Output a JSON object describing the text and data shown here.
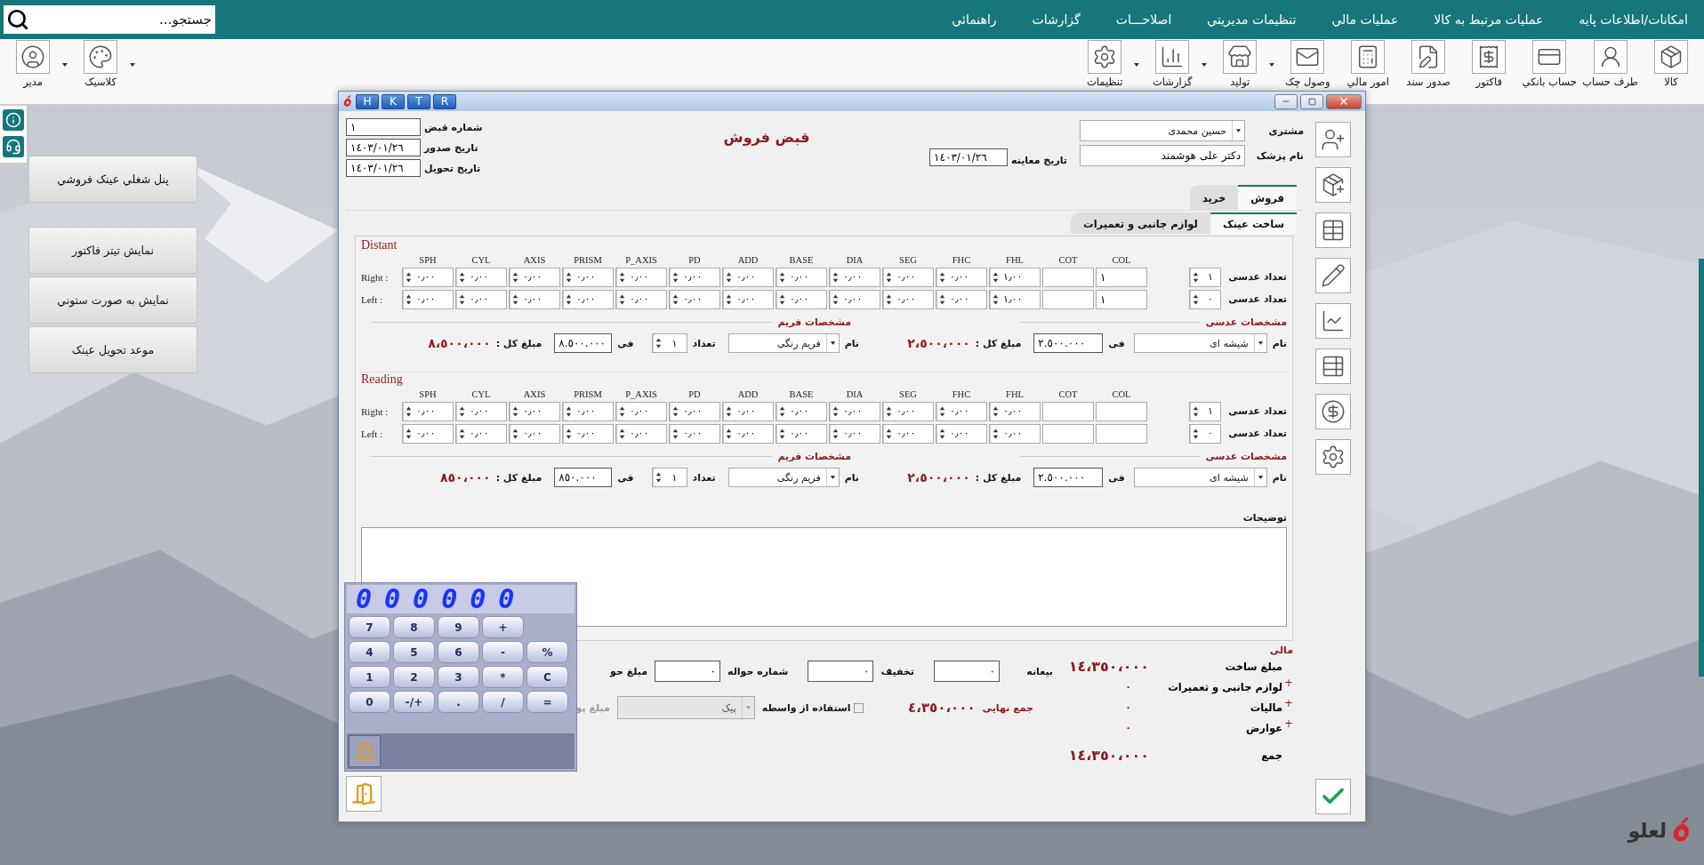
{
  "search": {
    "placeholder": "جستجو..."
  },
  "menu": [
    "امکانات/اطلاعات پایه",
    "عملیات مرتبط به کالا",
    "عملیات مالي",
    "تنظیمات مدیریتي",
    "اصلاحـــات",
    "گزارشات",
    "راهنمائي"
  ],
  "toolbar": [
    {
      "label": "کالا",
      "dropdown": false
    },
    {
      "label": "طرف حساب",
      "dropdown": false
    },
    {
      "label": "حساب بانکي",
      "dropdown": false
    },
    {
      "label": "فاکتور",
      "dropdown": false
    },
    {
      "label": "صدور سند",
      "dropdown": false
    },
    {
      "label": "امور مالي",
      "dropdown": false
    },
    {
      "label": "وصول چک",
      "dropdown": false
    },
    {
      "label": "تولید",
      "dropdown": true
    },
    {
      "label": "گزارشات",
      "dropdown": true
    },
    {
      "label": "تنظیمات",
      "dropdown": true
    }
  ],
  "user_tools": [
    {
      "label": "کلاسیک",
      "dropdown": true
    },
    {
      "label": "مدیر",
      "dropdown": true
    }
  ],
  "side_buttons": [
    "پنل شغلي عینک فروشي",
    "نمایش تیتر فاکتور",
    "نمایش به صورت ستوني",
    "موعد تحویل عینک"
  ],
  "logo": "لعلو",
  "dialog": {
    "title_buttons": [
      "R",
      "T",
      "K",
      "H"
    ],
    "title": "قبض فروش",
    "receipt": [
      {
        "label": "شماره قبض",
        "value": "١"
      },
      {
        "label": "تاریخ صدور",
        "value": "١٤٠٣/٠١/٢٦"
      },
      {
        "label": "تاریخ تحویل",
        "value": "١٤٠٣/٠١/٢٦"
      }
    ],
    "customer": {
      "label": "مشتری",
      "value": "حسین محمدی"
    },
    "doctor": {
      "label": "نام پزشک",
      "value": "دکتر علی هوشمند"
    },
    "exam_date": {
      "label": "تاریخ معاینه",
      "value": "١٤٠٣/٠١/٢٦"
    },
    "tabs": [
      {
        "label": "فروش",
        "selected": true
      },
      {
        "label": "خرید",
        "selected": false
      }
    ],
    "subtabs": [
      {
        "label": "ساخت عینک",
        "selected": true
      },
      {
        "label": "لوازم جانبی و تعمیرات",
        "selected": false
      }
    ],
    "prescriptions": [
      {
        "title": "Distant",
        "columns": [
          {
            "name": "COL",
            "kind": "text"
          },
          {
            "name": "COT",
            "kind": "text"
          },
          {
            "name": "FHL",
            "kind": "spin"
          },
          {
            "name": "FHC",
            "kind": "spin"
          },
          {
            "name": "SEG",
            "kind": "spin"
          },
          {
            "name": "DIA",
            "kind": "spin"
          },
          {
            "name": "BASE",
            "kind": "spin"
          },
          {
            "name": "ADD",
            "kind": "spin"
          },
          {
            "name": "PD",
            "kind": "spin"
          },
          {
            "name": "P_AXIS",
            "kind": "spin"
          },
          {
            "name": "PRISM",
            "kind": "spin"
          },
          {
            "name": "AXIS",
            "kind": "spin"
          },
          {
            "name": "CYL",
            "kind": "spin"
          },
          {
            "name": "SPH",
            "kind": "spin"
          }
        ],
        "rows": [
          {
            "label": "Right :",
            "cells": [
              "١",
              null,
              "١٫٠٠",
              "٠٫٠٠",
              "٠٫٠٠",
              "٠٫٠٠",
              "٠٫٠٠",
              "٠٫٠٠",
              "٠٫٠٠",
              "٠٫٠٠",
              "٠٫٠٠",
              "٠٫٠٠",
              "٠٫٠٠",
              "٠٫٠٠"
            ],
            "count_label": "تعداد عدسی",
            "count": "١"
          },
          {
            "label": "Left :",
            "cells": [
              "١",
              null,
              "١٫٠٠",
              "٠٫٠٠",
              "٠٫٠٠",
              "٠٫٠٠",
              "٠٫٠٠",
              "٠٫٠٠",
              "٠٫٠٠",
              "٠٫٠٠",
              "٠٫٠٠",
              "٠٫٠٠",
              "٠٫٠٠",
              "٠٫٠٠"
            ],
            "count_label": "تعداد عدسی",
            "count": "٠"
          }
        ],
        "lens": {
          "heading": "مشخصات عدسی",
          "name_label": "نام",
          "name": "شیشه ای",
          "fee_label": "فی",
          "fee": "٢.٥٠٠.٠٠٠",
          "total_label": "مبلغ کل :",
          "total": "٢،٥٠٠،٠٠٠"
        },
        "frame": {
          "heading": "مشخصات فریم",
          "name_label": "نام",
          "name": "فریم رنگی",
          "count_label": "تعداد",
          "count": "١",
          "fee_label": "فی",
          "fee": "٨.٥٠٠.٠٠٠",
          "total_label": "مبلغ کل :",
          "total": "٨،٥٠٠،٠٠٠"
        }
      },
      {
        "title": "Reading",
        "columns": [
          {
            "name": "COL",
            "kind": "text"
          },
          {
            "name": "COT",
            "kind": "text"
          },
          {
            "name": "FHL",
            "kind": "spin"
          },
          {
            "name": "FHC",
            "kind": "spin"
          },
          {
            "name": "SEG",
            "kind": "spin"
          },
          {
            "name": "DIA",
            "kind": "spin"
          },
          {
            "name": "BASE",
            "kind": "spin"
          },
          {
            "name": "ADD",
            "kind": "spin"
          },
          {
            "name": "PD",
            "kind": "spin"
          },
          {
            "name": "P_AXIS",
            "kind": "spin"
          },
          {
            "name": "PRISM",
            "kind": "spin"
          },
          {
            "name": "AXIS",
            "kind": "spin"
          },
          {
            "name": "CYL",
            "kind": "spin"
          },
          {
            "name": "SPH",
            "kind": "spin"
          }
        ],
        "rows": [
          {
            "label": "Right :",
            "cells": [
              null,
              null,
              "٠٫٠٠",
              "٠٫٠٠",
              "٠٫٠٠",
              "٠٫٠٠",
              "٠٫٠٠",
              "٠٫٠٠",
              "٠٫٠٠",
              "٠٫٠٠",
              "٠٫٠٠",
              "٠٫٠٠",
              "٠٫٠٠",
              "٠٫٠٠"
            ],
            "count_label": "تعداد عدسی",
            "count": "١"
          },
          {
            "label": "Left :",
            "cells": [
              null,
              null,
              "٠٫٠٠",
              "٠٫٠٠",
              "٠٫٠٠",
              "٠٫٠٠",
              "٠٫٠٠",
              "٠٫٠٠",
              "٠٫٠٠",
              "٠٫٠٠",
              "٠٫٠٠",
              "٠٫٠٠",
              "٠٫٠٠",
              "٠٫٠٠"
            ],
            "count_label": "تعداد عدسی",
            "count": "٠"
          }
        ],
        "lens": {
          "heading": "مشخصات عدسی",
          "name_label": "نام",
          "name": "شیشه ای",
          "fee_label": "فی",
          "fee": "٢.٥٠٠.٠٠٠",
          "total_label": "مبلغ کل :",
          "total": "٢،٥٠٠،٠٠٠"
        },
        "frame": {
          "heading": "مشخصات فریم",
          "name_label": "نام",
          "name": "فریم رنگی",
          "count_label": "تعداد",
          "count": "١",
          "fee_label": "فی",
          "fee": "٨٥٠.٠٠٠",
          "total_label": "مبلغ کل :",
          "total": "٨٥٠،٠٠٠"
        }
      }
    ],
    "notes_label": "توضیحات",
    "finance": {
      "heading": "مالی",
      "summary": [
        {
          "kind": "total",
          "label": "مبلغ ساخت",
          "value": "١٤،٣٥٠،٠٠٠"
        },
        {
          "kind": "added",
          "sign": "+",
          "label": "لوازم جانبی و تعمیرات",
          "value": "٠"
        },
        {
          "kind": "added",
          "sign": "+",
          "label": "مالیات",
          "value": "٠"
        },
        {
          "kind": "added",
          "sign": "+",
          "label": "عوارض",
          "value": "٠"
        },
        {
          "kind": "total",
          "label": "جمع",
          "value": "١٤،٣٥٠،٠٠٠"
        }
      ],
      "fields": [
        {
          "label": "بیعانه",
          "value": "٠"
        },
        {
          "label": "تخفیف",
          "value": "٠"
        },
        {
          "label": "شماره حواله",
          "value": "٠"
        }
      ],
      "transfer_amount_label": "مبلغ حو",
      "final": {
        "label": "جمع نهایی",
        "value": "٤،٣٥٠،٠٠٠"
      },
      "broker": {
        "label": "استفاده از واسطه",
        "checked": false
      },
      "courier": {
        "value": "پیک",
        "disabled": true
      },
      "courier_amount": {
        "label": "مبلغ پو",
        "disabled": true
      }
    },
    "calculator": {
      "display": "000000",
      "keys": [
        [
          "+",
          "9",
          "8",
          "7"
        ],
        [
          "%",
          "-",
          "6",
          "5",
          "4"
        ],
        [
          "C",
          "*",
          "3",
          "2",
          "1"
        ],
        [
          "=",
          "/",
          ".",
          "+/-",
          "0"
        ]
      ]
    }
  }
}
